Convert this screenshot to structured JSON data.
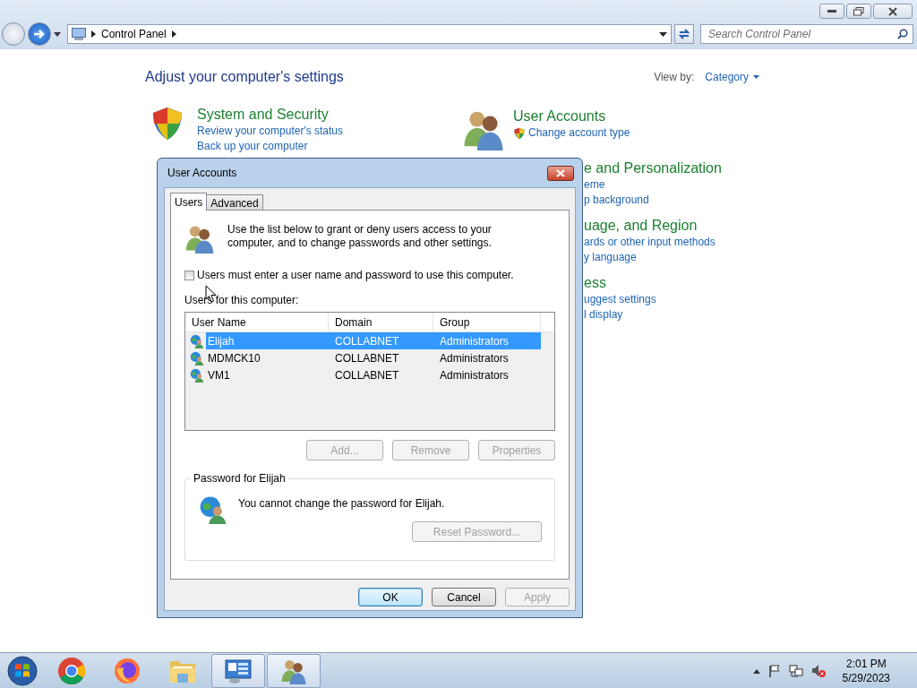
{
  "window": {
    "breadcrumb": [
      "Control Panel"
    ],
    "search": {
      "placeholder": "Search Control Panel"
    }
  },
  "page": {
    "heading": "Adjust your computer's settings",
    "view_by": {
      "label": "View by:",
      "value": "Category"
    }
  },
  "left_categories": [
    {
      "kind": "security",
      "title": "System and Security",
      "links": [
        {
          "text": "Review your computer's status",
          "shield": false
        },
        {
          "text": "Back up your computer",
          "shield": false
        }
      ]
    }
  ],
  "right_categories": [
    {
      "kind": "users",
      "title": "User Accounts",
      "links": [
        {
          "text": "Change account type",
          "shield": true
        }
      ]
    },
    {
      "kind": "covered",
      "title": "e and Personalization",
      "links": [
        {
          "text": "eme",
          "shield": false
        },
        {
          "text": "p background",
          "shield": false
        }
      ]
    },
    {
      "kind": "covered",
      "title": "uage, and Region",
      "links": [
        {
          "text": "ards or other input methods",
          "shield": false
        },
        {
          "text": "y language",
          "shield": false
        }
      ]
    },
    {
      "kind": "covered",
      "title": "ess",
      "links": [
        {
          "text": "uggest settings",
          "shield": false
        },
        {
          "text": "l display",
          "shield": false
        }
      ]
    }
  ],
  "dialog": {
    "title": "User Accounts",
    "tabs": [
      {
        "label": "Users",
        "selected": true
      },
      {
        "label": "Advanced",
        "selected": false
      }
    ],
    "intro": "Use the list below to grant or deny users access to your computer, and to change passwords and other settings.",
    "require_password": {
      "label": "Users must enter a user name and password to use this computer.",
      "checked": false
    },
    "users_label": "Users for this computer:",
    "table": {
      "columns": [
        "User Name",
        "Domain",
        "Group"
      ],
      "rows": [
        {
          "cells": [
            "Elijah",
            "COLLABNET",
            "Administrators"
          ],
          "selected": true
        },
        {
          "cells": [
            "MDMCK10",
            "COLLABNET",
            "Administrators"
          ],
          "selected": false
        },
        {
          "cells": [
            "VM1",
            "COLLABNET",
            "Administrators"
          ],
          "selected": false
        }
      ]
    },
    "list_buttons": [
      {
        "label": "Add...",
        "disabled": true
      },
      {
        "label": "Remove",
        "disabled": true
      },
      {
        "label": "Properties",
        "disabled": true
      }
    ],
    "password_group": {
      "title": "Password for Elijah",
      "message": "You cannot change the password for Elijah.",
      "button": {
        "label": "Reset Password...",
        "disabled": true
      }
    },
    "buttons": [
      {
        "label": "OK",
        "disabled": false,
        "default": true
      },
      {
        "label": "Cancel",
        "disabled": false,
        "default": false
      },
      {
        "label": "Apply",
        "disabled": true,
        "default": false
      }
    ]
  },
  "taskbar": {
    "items": [
      {
        "kind": "chrome",
        "active": false
      },
      {
        "kind": "firefox",
        "active": false
      },
      {
        "kind": "folder",
        "active": false
      },
      {
        "kind": "control-panel",
        "active": true
      },
      {
        "kind": "users",
        "active": true
      }
    ],
    "clock": {
      "time": "2:01 PM",
      "date": "5/29/2023"
    }
  }
}
